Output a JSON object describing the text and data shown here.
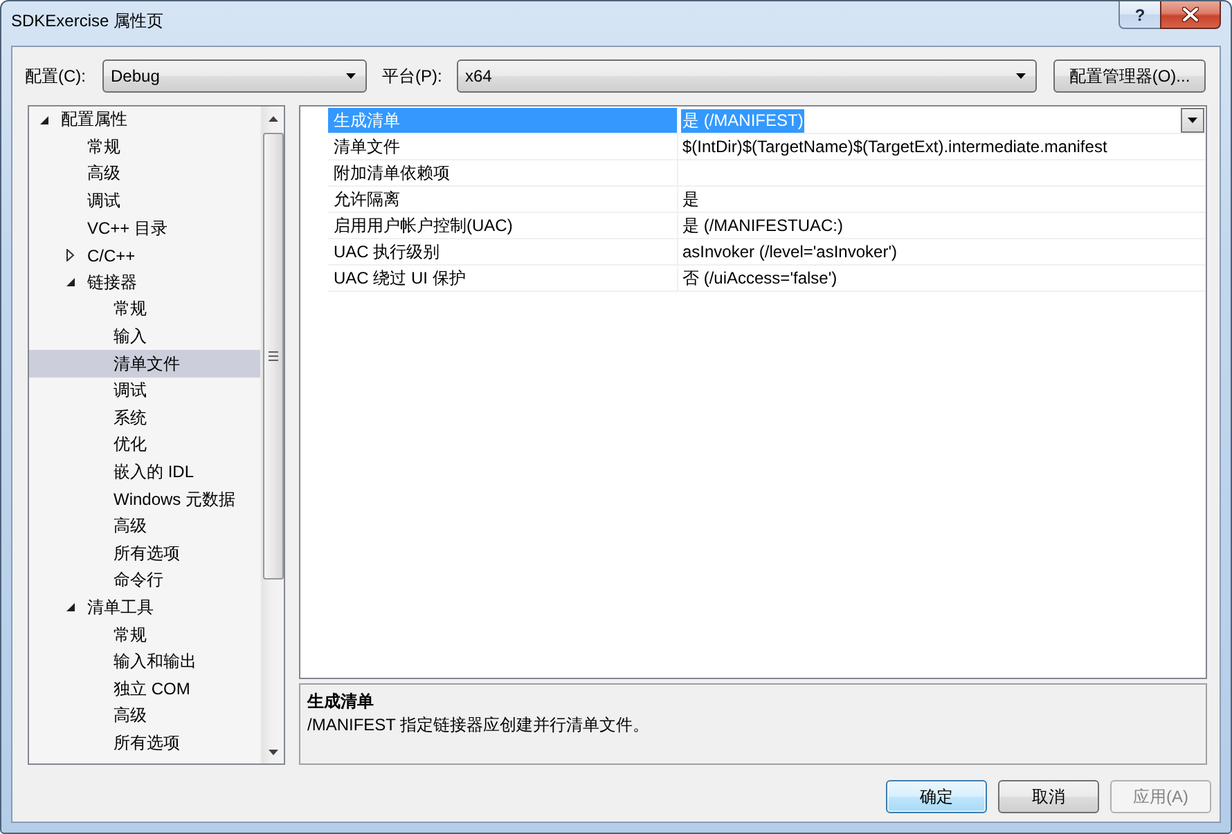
{
  "window": {
    "title": "SDKExercise 属性页",
    "help_button": "?"
  },
  "configuration": {
    "label": "配置(C):",
    "value": "Debug"
  },
  "platform": {
    "label": "平台(P):",
    "value": "x64"
  },
  "config_manager_button": "配置管理器(O)...",
  "tree": {
    "items": [
      {
        "label": "配置属性",
        "expanded": true,
        "selected": false,
        "children": [
          {
            "label": "常规",
            "selected": false
          },
          {
            "label": "高级",
            "selected": false
          },
          {
            "label": "调试",
            "selected": false
          },
          {
            "label": "VC++ 目录",
            "selected": false
          },
          {
            "label": "C/C++",
            "expanded": false,
            "selected": false
          },
          {
            "label": "链接器",
            "expanded": true,
            "selected": false,
            "children": [
              {
                "label": "常规",
                "selected": false
              },
              {
                "label": "输入",
                "selected": false
              },
              {
                "label": "清单文件",
                "selected": true
              },
              {
                "label": "调试",
                "selected": false
              },
              {
                "label": "系统",
                "selected": false
              },
              {
                "label": "优化",
                "selected": false
              },
              {
                "label": "嵌入的 IDL",
                "selected": false
              },
              {
                "label": "Windows 元数据",
                "selected": false
              },
              {
                "label": "高级",
                "selected": false
              },
              {
                "label": "所有选项",
                "selected": false
              },
              {
                "label": "命令行",
                "selected": false
              }
            ]
          },
          {
            "label": "清单工具",
            "expanded": true,
            "selected": false,
            "children": [
              {
                "label": "常规",
                "selected": false
              },
              {
                "label": "输入和输出",
                "selected": false
              },
              {
                "label": "独立 COM",
                "selected": false
              },
              {
                "label": "高级",
                "selected": false
              },
              {
                "label": "所有选项",
                "selected": false
              }
            ]
          }
        ]
      }
    ]
  },
  "properties": {
    "rows": [
      {
        "name": "生成清单",
        "value": "是 (/MANIFEST)",
        "selected": true
      },
      {
        "name": "清单文件",
        "value": "$(IntDir)$(TargetName)$(TargetExt).intermediate.manifest",
        "selected": false
      },
      {
        "name": "附加清单依赖项",
        "selected": false
      },
      {
        "name": "允许隔离",
        "value": "是",
        "selected": false
      },
      {
        "name": "启用用户帐户控制(UAC)",
        "value": "是 (/MANIFESTUAC:)",
        "selected": false
      },
      {
        "name": "UAC 执行级别",
        "value": "asInvoker (/level='asInvoker')",
        "selected": false
      },
      {
        "name": "UAC 绕过 UI 保护",
        "value": "否 (/uiAccess='false')",
        "selected": false
      }
    ]
  },
  "description": {
    "title": "生成清单",
    "text": "/MANIFEST 指定链接器应创建并行清单文件。"
  },
  "buttons": [
    {
      "label": "确定",
      "default": true,
      "disabled": false
    },
    {
      "label": "取消",
      "default": false,
      "disabled": false
    },
    {
      "label": "应用(A)",
      "default": false,
      "disabled": true
    }
  ]
}
